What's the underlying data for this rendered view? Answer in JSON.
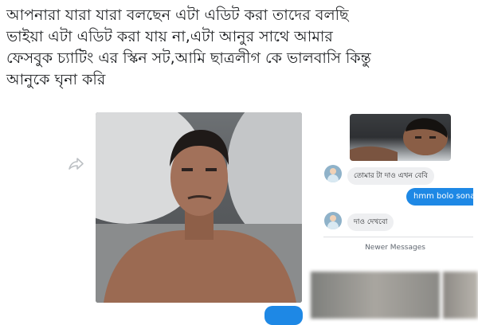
{
  "post": {
    "caption_lines": [
      "আপনারা যারা যারা বলছেন এটা এডিট করা তাদের বলছি",
      "ভাইয়া এটা এডিট করা যায় না,এটা আনুর সাথে আমার",
      "ফেসবুক চ্যাটিং এর স্কিন সট,আমি ছাত্রলীগ কে ভালবাসি কিন্তু",
      "আনুকে ঘৃনা করি"
    ]
  },
  "chat": {
    "messages": [
      {
        "direction": "incoming",
        "text": "তোমার টা দাও এখন বেবি"
      },
      {
        "direction": "outgoing",
        "text": "hmm bolo sona"
      },
      {
        "direction": "incoming",
        "text": "দাও দেখবো"
      }
    ],
    "newer_messages_label": "Newer Messages"
  },
  "icons": {
    "share": "share-arrow-icon",
    "avatar": "avatar"
  },
  "colors": {
    "accent_blue": "#1e88e5",
    "incoming_bubble": "#eeeff1",
    "text": "#1c1e21"
  }
}
